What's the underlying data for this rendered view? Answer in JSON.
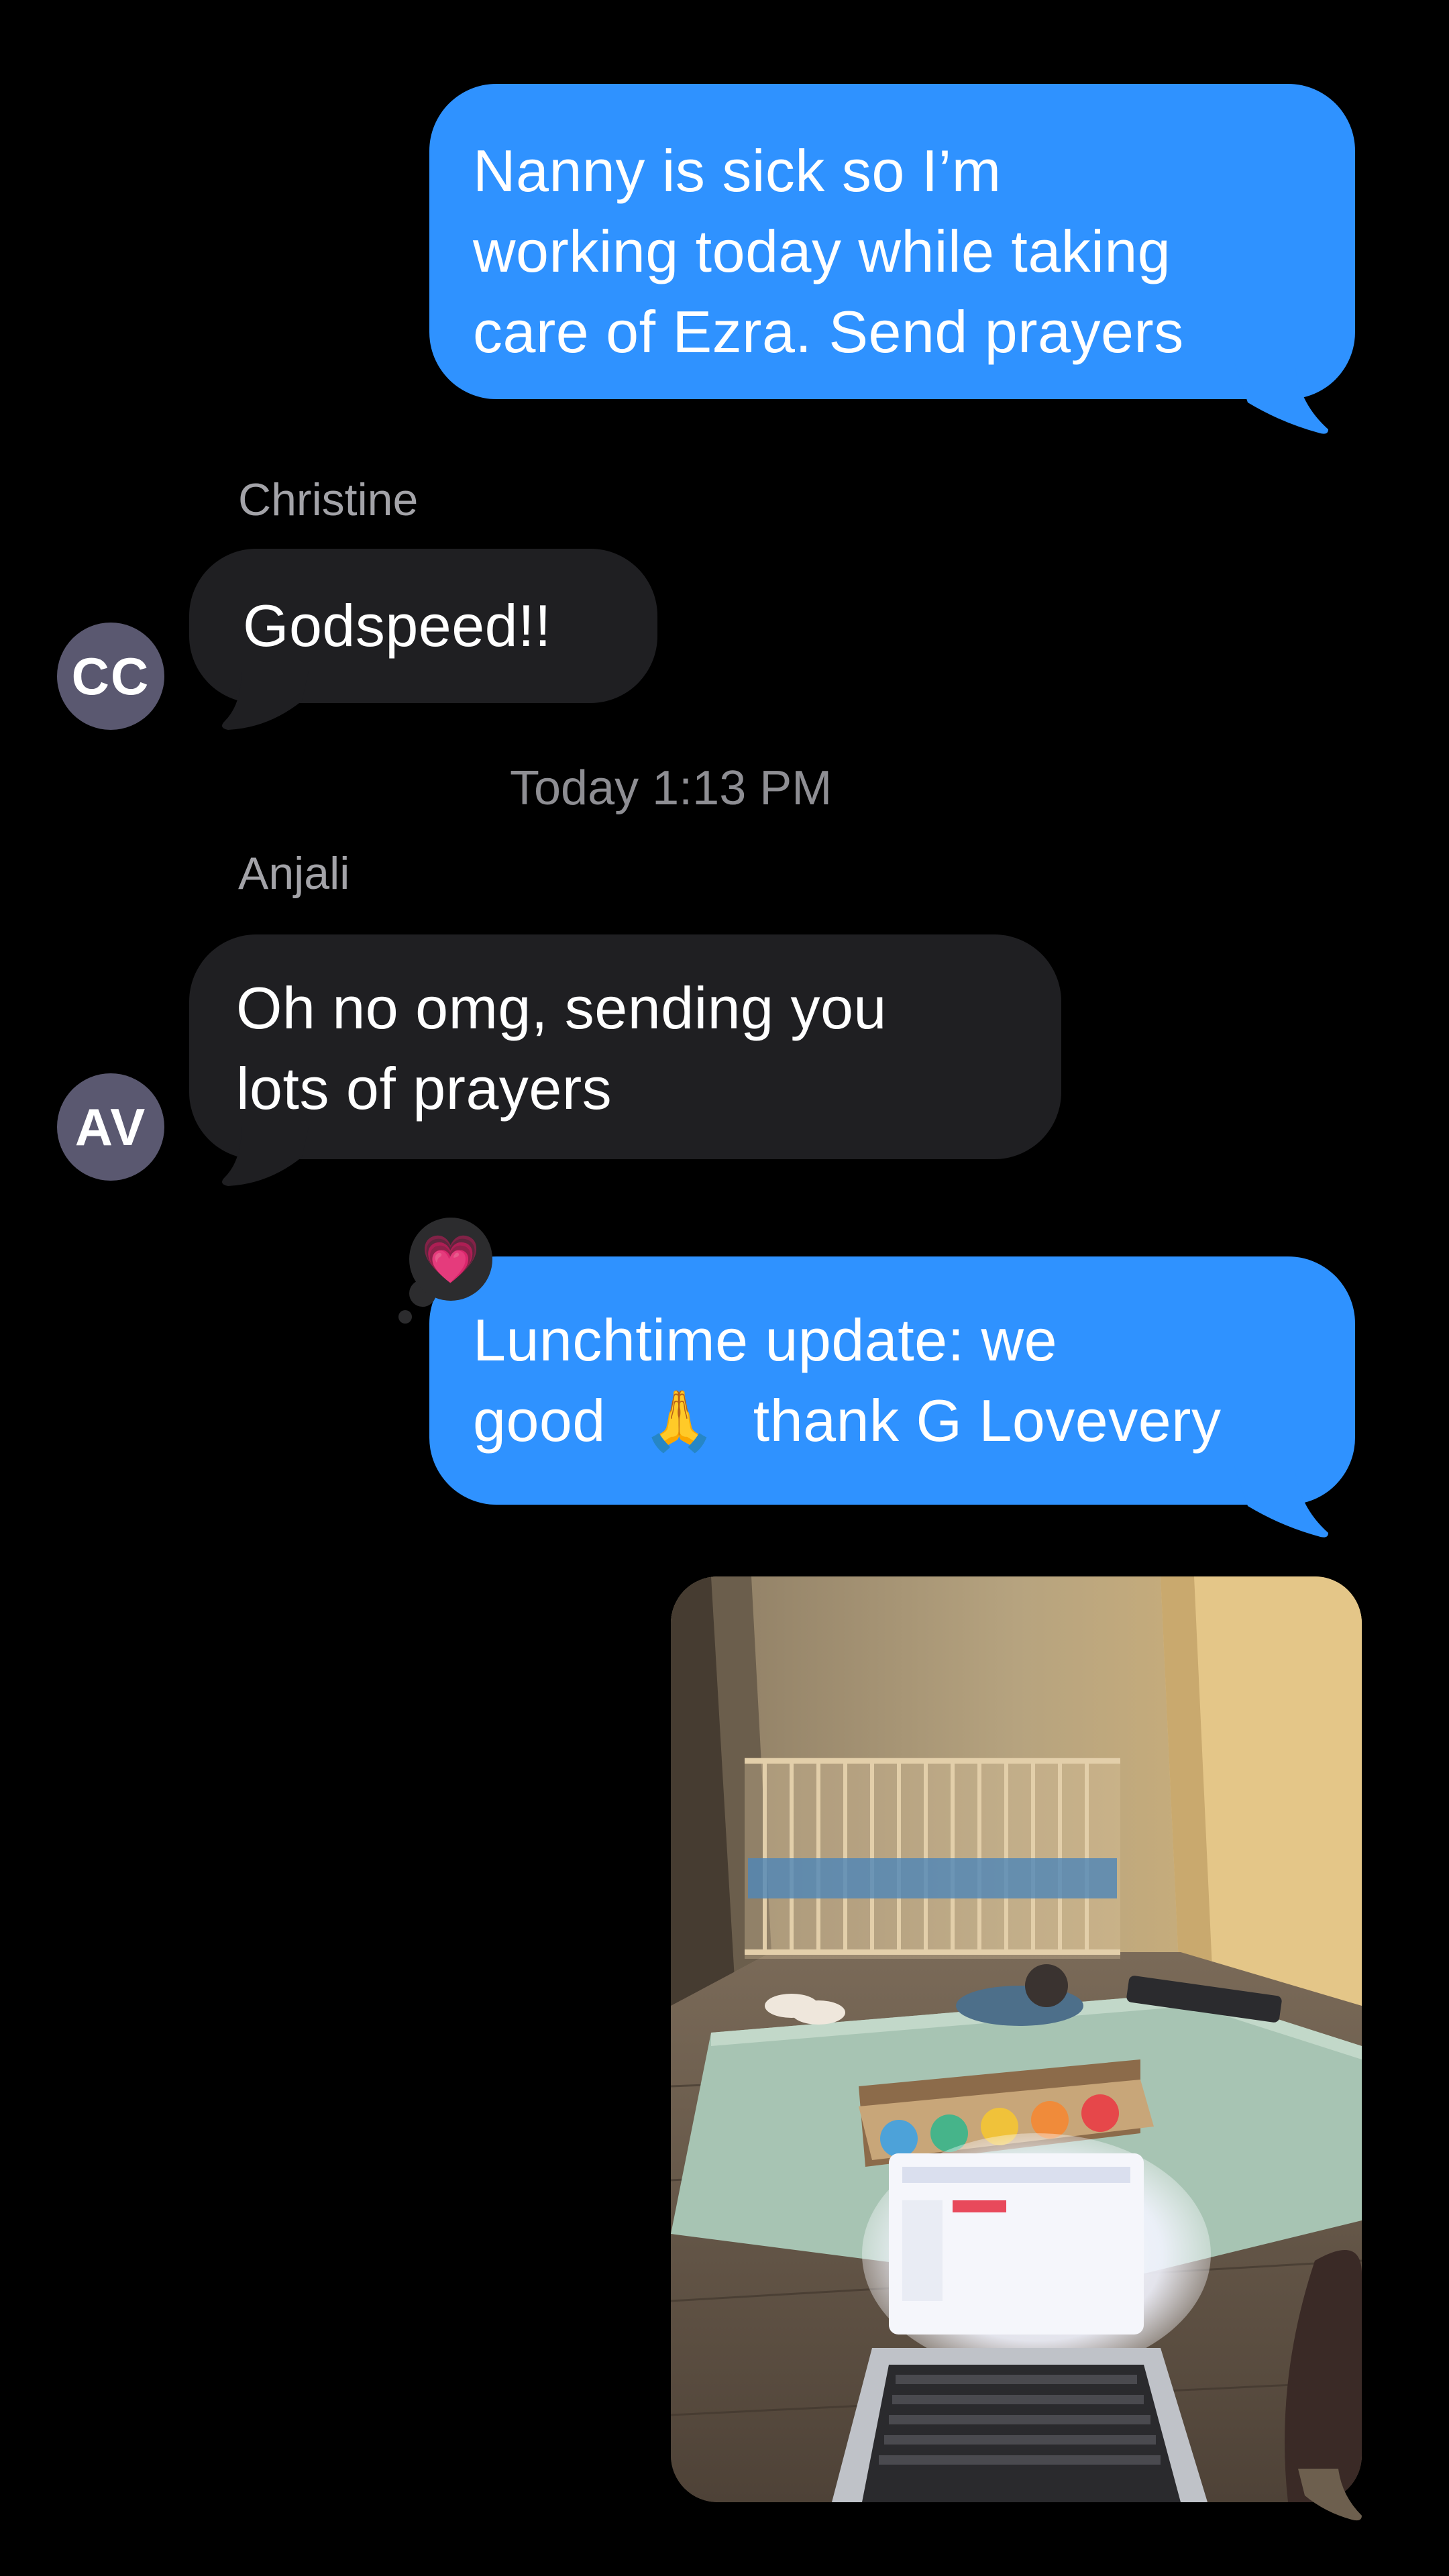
{
  "messages": {
    "m1": {
      "lines": [
        "Nanny is sick so I’m",
        "working today while taking",
        "care of Ezra. Send prayers"
      ]
    },
    "m2": {
      "sender": "Christine",
      "avatar_initials": "CC",
      "text": "Godspeed!!"
    },
    "timestamp": "Today 1:13 PM",
    "m3": {
      "sender": "Anjali",
      "avatar_initials": "AV",
      "lines": [
        "Oh no omg, sending you",
        "lots of prayers"
      ]
    },
    "m4": {
      "reaction_icon": "pink-heart-icon",
      "reaction_emoji": "💗",
      "line1": "Lunchtime update: we",
      "line2_before": "good",
      "line2_emoji": "🙏",
      "line2_after": "thank G Lovevery"
    },
    "m5": {
      "type": "photo",
      "photo_subject": "nursery-photo"
    }
  },
  "colors": {
    "background": "#000000",
    "outgoing_bubble": "#2f92ff",
    "incoming_bubble": "#1f1f22",
    "avatar": "#5a5870",
    "sender_label": "#a3a3a8",
    "timestamp": "#8e8e93"
  }
}
